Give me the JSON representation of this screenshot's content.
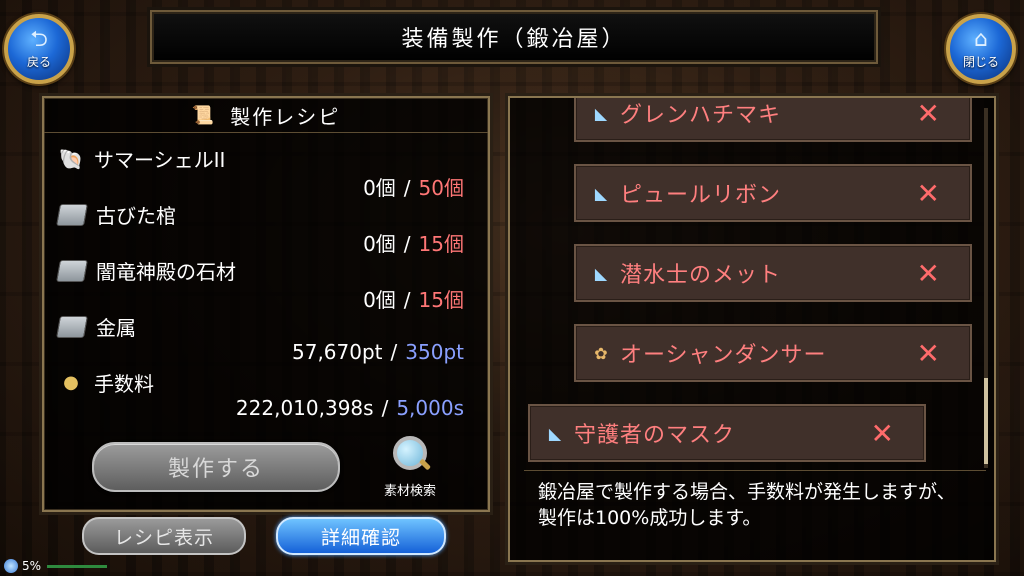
{
  "header": {
    "title": "装備製作（鍛冶屋）",
    "back_label": "戻る",
    "close_label": "閉じる"
  },
  "recipe": {
    "title": "製作レシピ",
    "materials": [
      {
        "name": "サマーシェルII",
        "have": "0個",
        "need": "50個",
        "need_color": "red",
        "icon": "shell-icon"
      },
      {
        "name": "古びた棺",
        "have": "0個",
        "need": "15個",
        "need_color": "red",
        "icon": "coffin-icon"
      },
      {
        "name": "闇竜神殿の石材",
        "have": "0個",
        "need": "15個",
        "need_color": "red",
        "icon": "coffin-icon"
      },
      {
        "name": "金属",
        "have": "57,670pt",
        "need": "350pt",
        "need_color": "blue",
        "icon": "coffin-icon"
      },
      {
        "name": "手数料",
        "have": "222,010,398s",
        "need": "5,000s",
        "need_color": "blue",
        "icon": "coins-icon"
      }
    ],
    "separator": "/",
    "craft_label": "製作する",
    "search_label": "素材検索"
  },
  "buttons": {
    "recipe_display": "レシピ表示",
    "detail_confirm": "詳細確認"
  },
  "equipment_list": [
    {
      "name": "グレンハチマキ",
      "icon": "hat-icon"
    },
    {
      "name": "ピュールリボン",
      "icon": "hat-icon"
    },
    {
      "name": "潜水士のメット",
      "icon": "hat-icon"
    },
    {
      "name": "オーシャンダンサー",
      "icon": "dancer-icon"
    },
    {
      "name": "守護者のマスク",
      "icon": "hat-icon"
    }
  ],
  "x_mark": "✕",
  "description": "鍛冶屋で製作する場合、手数料が発生しますが、製作は100%成功します。",
  "status": {
    "percent": "5%"
  },
  "colors": {
    "need_red": "#ff7676",
    "need_blue": "#8aa0ff",
    "item_red": "#ff7f7f",
    "panel_border": "#8a7650"
  }
}
